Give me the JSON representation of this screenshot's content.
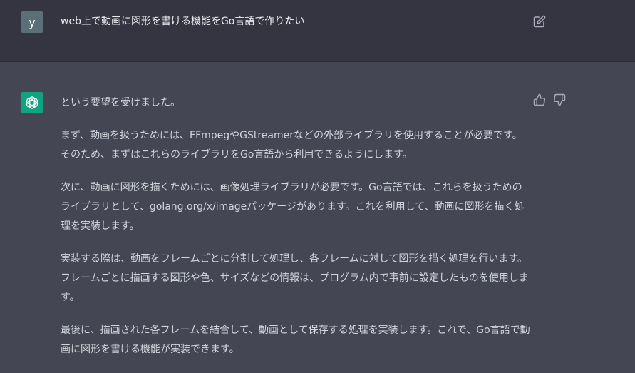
{
  "user": {
    "avatar_letter": "y",
    "message": "web上で動画に図形を書ける機能をGo言語で作りたい"
  },
  "assistant": {
    "paragraphs": [
      "という要望を受けました。",
      "まず、動画を扱うためには、FFmpegやGStreamerなどの外部ライブラリを使用することが必要です。そのため、まずはこれらのライブラリをGo言語から利用できるようにします。",
      "次に、動画に図形を描くためには、画像処理ライブラリが必要です。Go言語では、これらを扱うためのライブラリとして、golang.org/x/imageパッケージがあります。これを利用して、動画に図形を描く処理を実装します。",
      "実装する際は、動画をフレームごとに分割して処理し、各フレームに対して図形を描く処理を行います。フレームごとに描画する図形や色、サイズなどの情報は、プログラム内で事前に設定したものを使用します。",
      "最後に、描画された各フレームを結合して、動画として保存する処理を実装します。これで、Go言語で動画に図形を書ける機能が実装できます。"
    ]
  },
  "colors": {
    "user_bg": "#343541",
    "assistant_bg": "#444654",
    "bot_avatar": "#10a37f",
    "user_avatar": "#5a6f78"
  },
  "icons": {
    "edit": "edit-icon",
    "thumb_up": "thumbs-up-icon",
    "thumb_down": "thumbs-down-icon",
    "bot": "openai-logo-icon"
  }
}
